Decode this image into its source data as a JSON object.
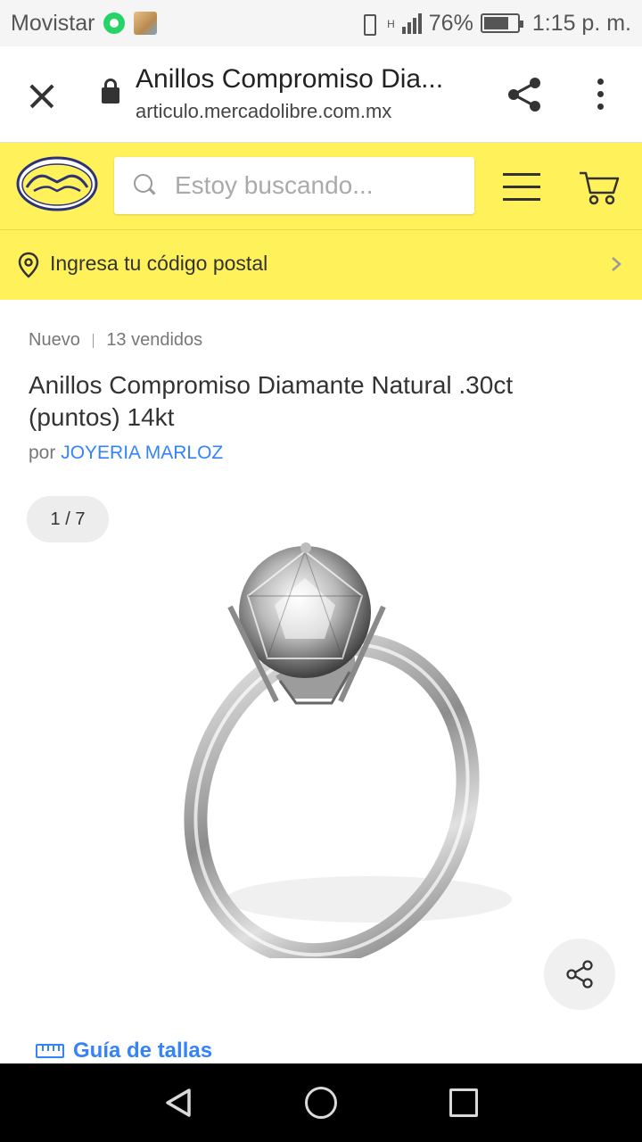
{
  "status_bar": {
    "carrier": "Movistar",
    "network_type": "H",
    "battery": "76%",
    "time": "1:15 p. m."
  },
  "browser": {
    "title": "Anillos Compromiso Dia...",
    "url": "articulo.mercadolibre.com.mx"
  },
  "header": {
    "search_placeholder": "Estoy buscando..."
  },
  "postal": {
    "label": "Ingresa tu código postal"
  },
  "product": {
    "condition": "Nuevo",
    "sold": "13 vendidos",
    "title": "Anillos Compromiso Diamante Natural .30ct (puntos) 14kt",
    "seller_prefix": "por",
    "seller": "JOYERIA MARLOZ",
    "image_counter": "1 / 7",
    "size_guide": "Guía de tallas"
  },
  "colors": {
    "brand_yellow": "#fff159",
    "link_blue": "#3483fa"
  },
  "icons": [
    "whatsapp-icon",
    "photo-notification-icon",
    "vibrate-icon",
    "signal-icon",
    "battery-icon",
    "close-icon",
    "lock-icon",
    "share-icon",
    "more-vert-icon",
    "mercadolibre-logo",
    "search-icon",
    "hamburger-icon",
    "cart-icon",
    "location-pin-icon",
    "chevron-right-icon",
    "ruler-icon",
    "back-icon",
    "home-icon",
    "recent-apps-icon"
  ]
}
